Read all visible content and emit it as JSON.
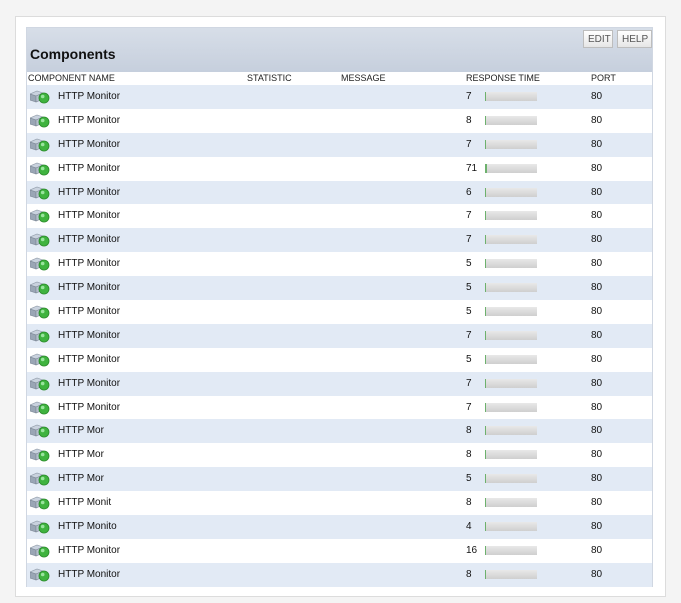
{
  "panel": {
    "title": "Components",
    "edit_label": "EDIT",
    "help_label": "HELP"
  },
  "columns": {
    "name": "COMPONENT NAME",
    "statistic": "STATISTIC",
    "message": "MESSAGE",
    "response": "RESPONSE TIME",
    "port": "PORT"
  },
  "colors": {
    "row_alt": "#e2eaf5",
    "header_bg": "#c6cfdd",
    "status_ok": "#3fb33f"
  },
  "rows": [
    {
      "name": "HTTP Monitor",
      "response": "7",
      "port": "80"
    },
    {
      "name": "HTTP Monitor",
      "response": "8",
      "port": "80"
    },
    {
      "name": "HTTP Monitor",
      "response": "7",
      "port": "80"
    },
    {
      "name": "HTTP Monitor",
      "response": "71",
      "port": "80"
    },
    {
      "name": "HTTP Monitor",
      "response": "6",
      "port": "80"
    },
    {
      "name": "HTTP Monitor",
      "response": "7",
      "port": "80"
    },
    {
      "name": "HTTP Monitor",
      "response": "7",
      "port": "80"
    },
    {
      "name": "HTTP Monitor",
      "response": "5",
      "port": "80"
    },
    {
      "name": "HTTP Monitor",
      "response": "5",
      "port": "80"
    },
    {
      "name": "HTTP Monitor",
      "response": "5",
      "port": "80"
    },
    {
      "name": "HTTP Monitor",
      "response": "7",
      "port": "80"
    },
    {
      "name": "HTTP Monitor",
      "response": "5",
      "port": "80"
    },
    {
      "name": "HTTP Monitor",
      "response": "7",
      "port": "80"
    },
    {
      "name": "HTTP Monitor",
      "response": "7",
      "port": "80"
    },
    {
      "name": "HTTP Mor",
      "response": "8",
      "port": "80"
    },
    {
      "name": "HTTP Mor",
      "response": "8",
      "port": "80"
    },
    {
      "name": "HTTP Mor",
      "response": "5",
      "port": "80"
    },
    {
      "name": "HTTP Monit",
      "response": "8",
      "port": "80"
    },
    {
      "name": "HTTP Monito",
      "response": "4",
      "port": "80"
    },
    {
      "name": "HTTP Monitor",
      "response": "16",
      "port": "80"
    },
    {
      "name": "HTTP Monitor",
      "response": "8",
      "port": "80"
    }
  ]
}
